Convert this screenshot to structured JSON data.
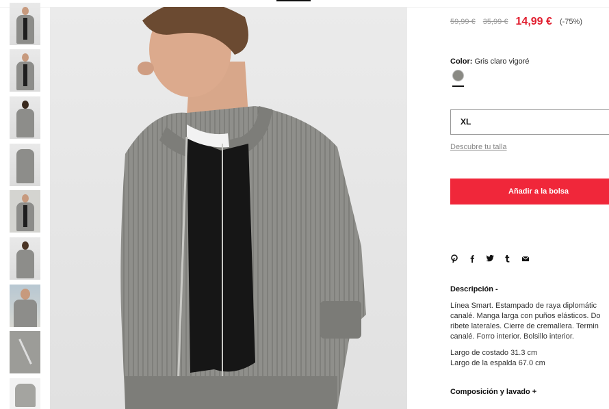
{
  "product": {
    "prices": {
      "original": "59,99 €",
      "previous": "35,99 €",
      "current": "14,99 €",
      "discount": "(-75%)"
    },
    "color": {
      "label": "Color:",
      "value": "Gris claro vigoré",
      "swatch_hex": "#8a8a84"
    },
    "size": {
      "selected": "XL",
      "guide_link": "Descubre tu talla"
    },
    "add_to_bag": "Añadir a la bolsa",
    "share_icons": [
      "pinterest-icon",
      "facebook-icon",
      "twitter-icon",
      "tumblr-icon",
      "email-icon"
    ],
    "description": {
      "title": "Descripción -",
      "lines": [
        "Línea Smart. Estampado de raya diplomátic",
        "canalé. Manga larga con puños elásticos. Do",
        "ribete laterales. Cierre de cremallera. Termin",
        "canalé. Forro interior. Bolsillo interior."
      ],
      "measurements": [
        "Largo de costado 31.3 cm",
        "Largo de la espalda 67.0 cm"
      ]
    },
    "composition": "Composición y lavado +"
  },
  "gallery": {
    "thumbnail_count": 9,
    "main_image_alt": "product-photo"
  },
  "colors": {
    "accent": "#f0273a",
    "sale_price": "#e11d2e"
  }
}
